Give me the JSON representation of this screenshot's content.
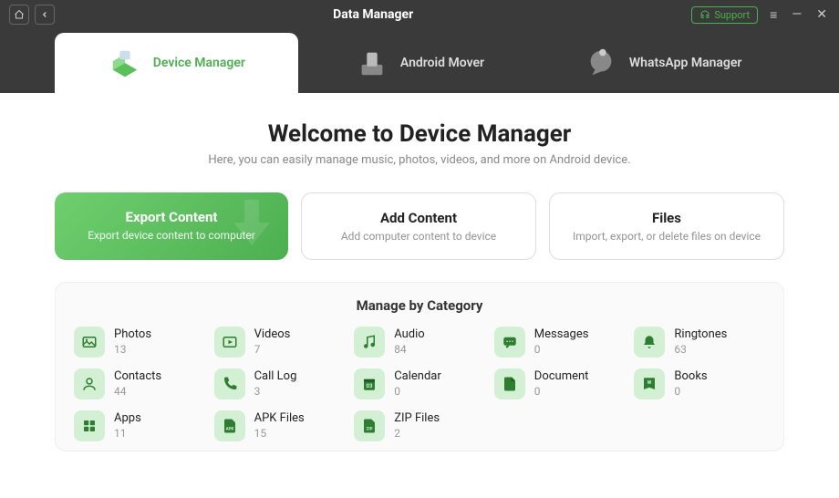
{
  "titlebar": {
    "title": "Data Manager",
    "support": "Support"
  },
  "tabs": [
    {
      "label": "Device Manager"
    },
    {
      "label": "Android Mover"
    },
    {
      "label": "WhatsApp Manager"
    }
  ],
  "main": {
    "welcome": "Welcome to Device Manager",
    "subtitle": "Here, you can easily manage music, photos, videos, and more on Android device."
  },
  "actions": [
    {
      "title": "Export Content",
      "sub": "Export device content to computer"
    },
    {
      "title": "Add Content",
      "sub": "Add computer content to device"
    },
    {
      "title": "Files",
      "sub": "Import, export, or delete files on device"
    }
  ],
  "categories": {
    "title": "Manage by Category",
    "items": [
      {
        "name": "Photos",
        "count": "13",
        "icon": "photo"
      },
      {
        "name": "Videos",
        "count": "7",
        "icon": "video"
      },
      {
        "name": "Audio",
        "count": "84",
        "icon": "audio"
      },
      {
        "name": "Messages",
        "count": "0",
        "icon": "message"
      },
      {
        "name": "Ringtones",
        "count": "63",
        "icon": "ringtone"
      },
      {
        "name": "Contacts",
        "count": "44",
        "icon": "contact"
      },
      {
        "name": "Call Log",
        "count": "3",
        "icon": "calllog"
      },
      {
        "name": "Calendar",
        "count": "0",
        "icon": "calendar"
      },
      {
        "name": "Document",
        "count": "0",
        "icon": "document"
      },
      {
        "name": "Books",
        "count": "0",
        "icon": "book"
      },
      {
        "name": "Apps",
        "count": "11",
        "icon": "apps"
      },
      {
        "name": "APK Files",
        "count": "15",
        "icon": "apk"
      },
      {
        "name": "ZIP Files",
        "count": "2",
        "icon": "zip"
      }
    ]
  }
}
